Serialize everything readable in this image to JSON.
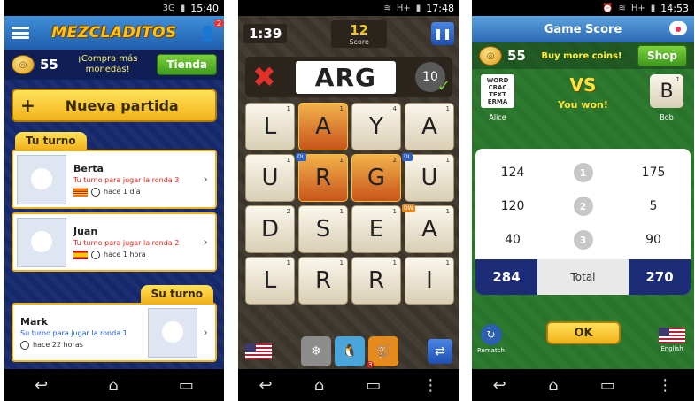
{
  "p1": {
    "statusbar_time": "15:40",
    "statusbar_net": "3G",
    "logo": "MEZCLADITOS",
    "friends_badge": "2",
    "coins": "55",
    "buy_text_1": "¡Compra más",
    "buy_text_2": "monedas!",
    "shop_label": "Tienda",
    "new_game_label": "Nueva partida",
    "your_turn_tab": "Tu turno",
    "their_turn_tab": "Su turno",
    "your_turn_cards": [
      {
        "name": "Berta",
        "msg": "Tu turno para jugar la ronda 3",
        "time": "hace 1 día"
      },
      {
        "name": "Juan",
        "msg": "Tu turno para jugar la ronda 2",
        "time": "hace 1 hora"
      }
    ],
    "their_turn_cards": [
      {
        "name": "Mark",
        "msg": "Su turno para jugar la ronda 1",
        "time": "hace 22 horas"
      }
    ]
  },
  "p2": {
    "statusbar_time": "17:48",
    "statusbar_net": "H+",
    "timer": "1:39",
    "score_value": "12",
    "score_label": "Score",
    "current_word": "ARG",
    "word_points": "10",
    "powerup_count": "3",
    "tiles": [
      {
        "letter": "L",
        "value": "1",
        "bonus": "",
        "selected": false
      },
      {
        "letter": "A",
        "value": "1",
        "bonus": "",
        "selected": true
      },
      {
        "letter": "Y",
        "value": "4",
        "bonus": "",
        "selected": false
      },
      {
        "letter": "A",
        "value": "1",
        "bonus": "",
        "selected": false
      },
      {
        "letter": "U",
        "value": "1",
        "bonus": "",
        "selected": false
      },
      {
        "letter": "R",
        "value": "1",
        "bonus": "DL",
        "selected": true
      },
      {
        "letter": "G",
        "value": "2",
        "bonus": "",
        "selected": true
      },
      {
        "letter": "U",
        "value": "1",
        "bonus": "DL",
        "selected": false
      },
      {
        "letter": "D",
        "value": "2",
        "bonus": "",
        "selected": false
      },
      {
        "letter": "S",
        "value": "1",
        "bonus": "",
        "selected": false
      },
      {
        "letter": "E",
        "value": "1",
        "bonus": "",
        "selected": false
      },
      {
        "letter": "A",
        "value": "1",
        "bonus": "DW",
        "selected": false
      },
      {
        "letter": "L",
        "value": "1",
        "bonus": "",
        "selected": false
      },
      {
        "letter": "R",
        "value": "1",
        "bonus": "",
        "selected": false
      },
      {
        "letter": "R",
        "value": "1",
        "bonus": "",
        "selected": false
      },
      {
        "letter": "I",
        "value": "1",
        "bonus": "",
        "selected": false
      }
    ]
  },
  "p3": {
    "statusbar_time": "14:53",
    "statusbar_net": "H+",
    "title": "Game Score",
    "coins": "55",
    "buy_text": "Buy more coins!",
    "shop_label": "Shop",
    "player_left": "Alice",
    "player_right": "Bob",
    "player_left_pic_text": "WORD CRAC TEXT ERMA",
    "player_right_tile": "B",
    "player_right_tile_value": "1",
    "vs": "VS",
    "result": "You won!",
    "rounds": [
      {
        "round": "1",
        "left": "124",
        "right": "175"
      },
      {
        "round": "2",
        "left": "120",
        "right": "5"
      },
      {
        "round": "3",
        "left": "40",
        "right": "90"
      }
    ],
    "total_left": "284",
    "total_label": "Total",
    "total_right": "270",
    "ok_label": "OK",
    "rematch_label": "Rematch",
    "language_label": "English"
  }
}
